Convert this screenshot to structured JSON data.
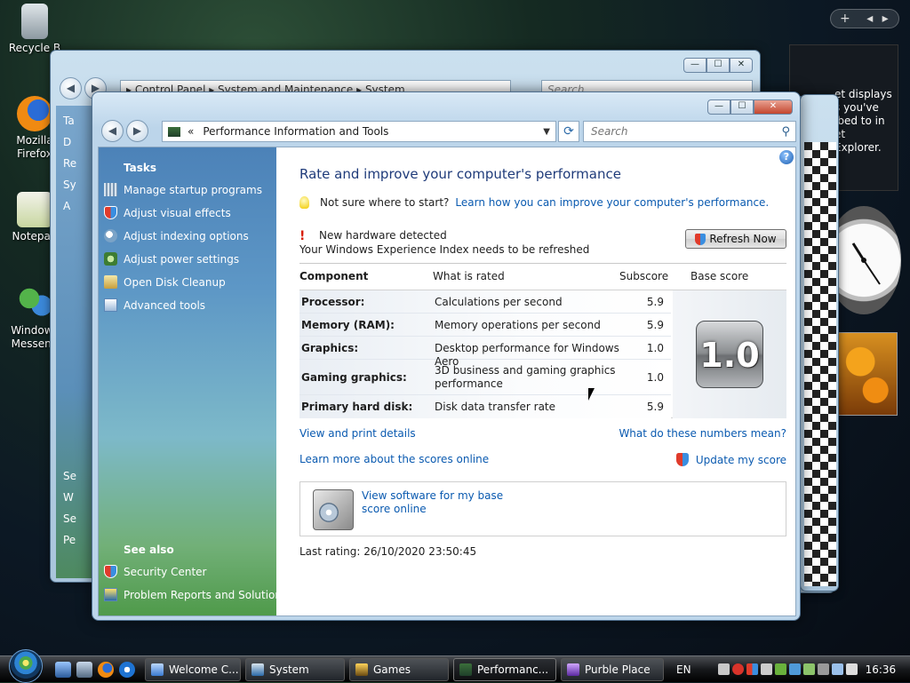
{
  "desktop": {
    "icons": [
      {
        "label": "Recycle B"
      },
      {
        "label": "Mozilla Firefox"
      },
      {
        "label": "Notepad"
      },
      {
        "label": "Windows Messeng"
      }
    ]
  },
  "gadgets": {
    "feed_text": "et displays s you've ibed to in et Explorer.",
    "bar_plus": "+"
  },
  "bg_window": {
    "address": "▸  Control Panel  ▸  System and Maintenance  ▸  System",
    "search_placeholder": "Search",
    "sidebar_labels": [
      "Ta",
      "D",
      "Re",
      "Sy",
      "A",
      "Se",
      "W",
      "Se",
      "Pe"
    ]
  },
  "window": {
    "address_prefix": "«",
    "address": "Performance Information and Tools",
    "search_placeholder": "Search",
    "buttons": {
      "minimize": "—",
      "maximize": "☐",
      "close": "✕"
    }
  },
  "sidebar": {
    "tasks_heading": "Tasks",
    "tasks": [
      {
        "label": "Manage startup programs",
        "icon": "startup-icon"
      },
      {
        "label": "Adjust visual effects",
        "icon": "shield-icon"
      },
      {
        "label": "Adjust indexing options",
        "icon": "indexing-icon"
      },
      {
        "label": "Adjust power settings",
        "icon": "power-icon"
      },
      {
        "label": "Open Disk Cleanup",
        "icon": "disk-cleanup-icon"
      },
      {
        "label": "Advanced tools",
        "icon": "advanced-tools-icon"
      }
    ],
    "see_also_heading": "See also",
    "see_also": [
      {
        "label": "Security Center",
        "icon": "shield-icon"
      },
      {
        "label": "Problem Reports and Solutions",
        "icon": "problem-reports-icon"
      }
    ]
  },
  "main": {
    "title": "Rate and improve your computer's performance",
    "hint_text": "Not sure where to start?",
    "hint_link": "Learn how you can improve your computer's performance.",
    "alert_title": "New hardware detected",
    "alert_text": "Your Windows Experience Index needs to be refreshed",
    "refresh_button": "Refresh Now",
    "table": {
      "headers": {
        "component": "Component",
        "rated": "What is rated",
        "subscore": "Subscore",
        "base": "Base score"
      },
      "rows": [
        {
          "component": "Processor:",
          "rated": "Calculations per second",
          "subscore": "5.9"
        },
        {
          "component": "Memory (RAM):",
          "rated": "Memory operations per second",
          "subscore": "5.9"
        },
        {
          "component": "Graphics:",
          "rated": "Desktop performance for Windows Aero",
          "subscore": "1.0"
        },
        {
          "component": "Gaming graphics:",
          "rated": "3D business and gaming graphics performance",
          "subscore": "1.0"
        },
        {
          "component": "Primary hard disk:",
          "rated": "Disk data transfer rate",
          "subscore": "5.9"
        }
      ],
      "base_score": "1.0"
    },
    "link_view_print": "View and print details",
    "link_numbers": "What do these numbers mean?",
    "link_learn_scores": "Learn more about the scores online",
    "link_update": "Update my score",
    "software_link": "View software for my base score online",
    "last_rating": "Last rating: 26/10/2020 23:50:45"
  },
  "taskbar": {
    "items": [
      {
        "label": "Welcome C...",
        "icon": "welcome-icon"
      },
      {
        "label": "System",
        "icon": "system-icon"
      },
      {
        "label": "Games",
        "icon": "games-icon"
      },
      {
        "label": "Performanc...",
        "icon": "performance-icon"
      },
      {
        "label": "Purble Place",
        "icon": "purble-place-icon"
      }
    ],
    "lang": "EN",
    "clock": "16:36"
  },
  "colors": {
    "link": "#0a5ab0",
    "title": "#1f3b7a",
    "pane_top": "#4c82b8",
    "pane_bottom": "#4f9a4a"
  }
}
